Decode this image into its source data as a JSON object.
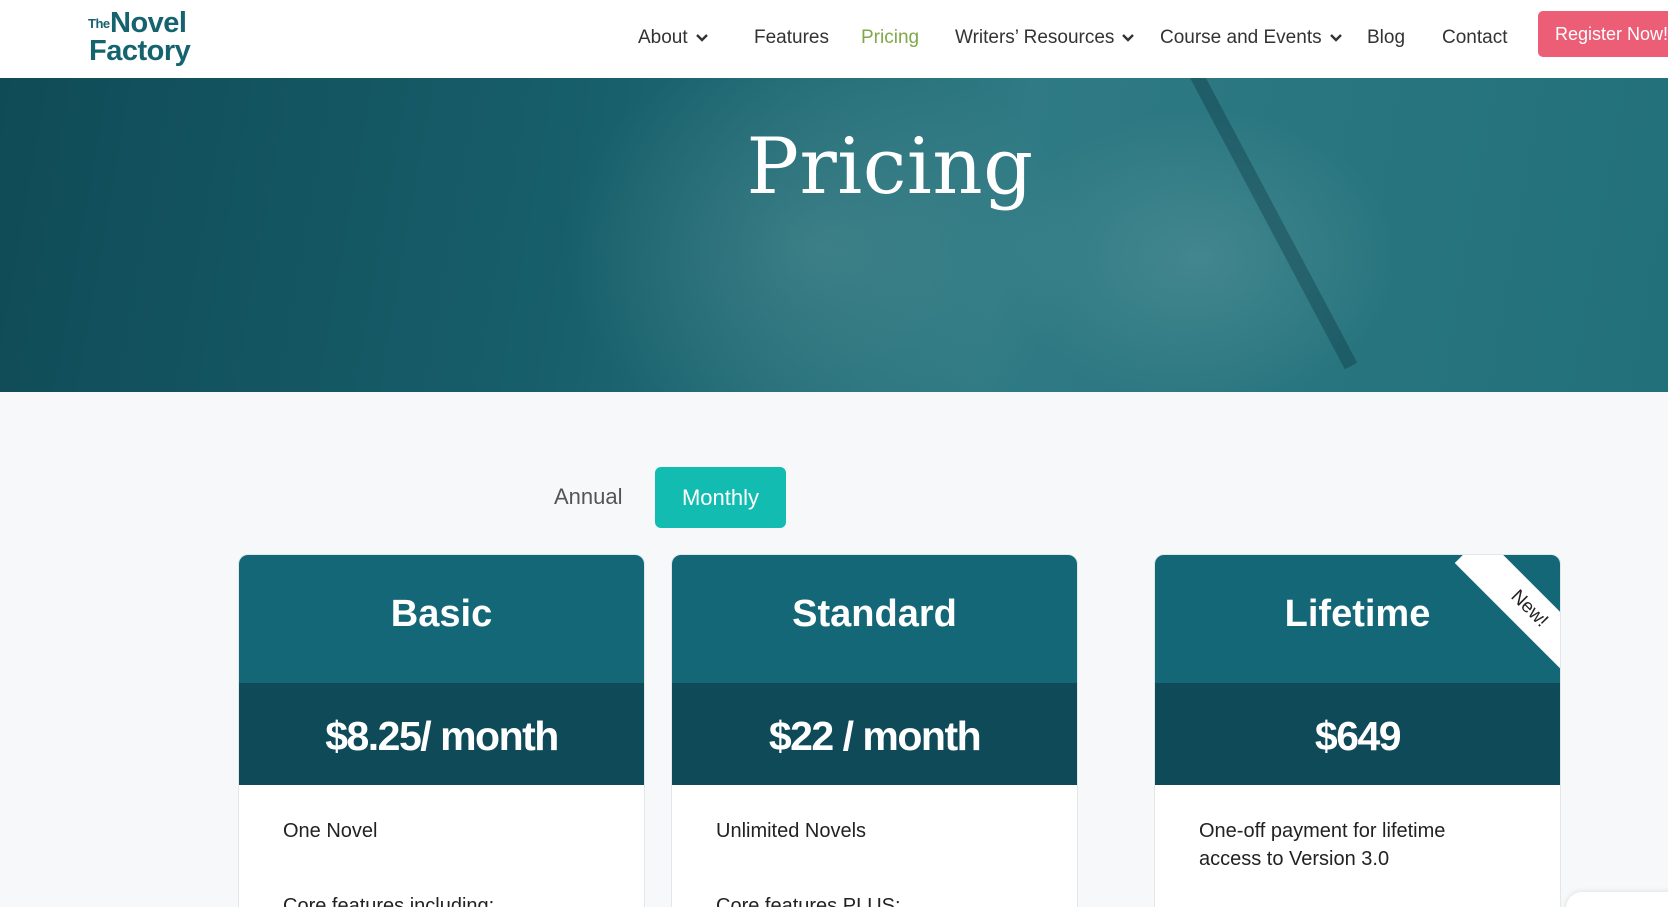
{
  "brand": {
    "logo_the": "The",
    "logo_novel": "Novel",
    "logo_factory": "Factory"
  },
  "nav": {
    "items": [
      {
        "label": "About",
        "has_dropdown": true
      },
      {
        "label": "Features",
        "has_dropdown": false
      },
      {
        "label": "Pricing",
        "has_dropdown": false,
        "active": true
      },
      {
        "label": "Writers’ Resources",
        "has_dropdown": true
      },
      {
        "label": "Course and Events",
        "has_dropdown": true
      },
      {
        "label": "Blog",
        "has_dropdown": false
      },
      {
        "label": "Contact",
        "has_dropdown": false
      }
    ],
    "register_label": "Register Now!"
  },
  "hero": {
    "title": "Pricing"
  },
  "billing_toggle": {
    "annual_label": "Annual",
    "monthly_label": "Monthly",
    "selected": "Monthly"
  },
  "plans": [
    {
      "name": "Basic",
      "price": "$8.25/ month",
      "feature": "One Novel",
      "subheading": "Core features including:"
    },
    {
      "name": "Standard",
      "price": "$22 / month",
      "feature": "Unlimited Novels",
      "subheading": "Core features PLUS:"
    },
    {
      "name": "Lifetime",
      "price": "$649",
      "feature": "One-off payment for lifetime access to Version 3.0",
      "badge": "New!"
    }
  ],
  "colors": {
    "brand_teal": "#15636f",
    "card_head": "#136777",
    "card_price_band": "#0e4a58",
    "toggle_active": "#12bcb0",
    "register_button": "#ec5d76",
    "nav_active": "#7fa848"
  }
}
